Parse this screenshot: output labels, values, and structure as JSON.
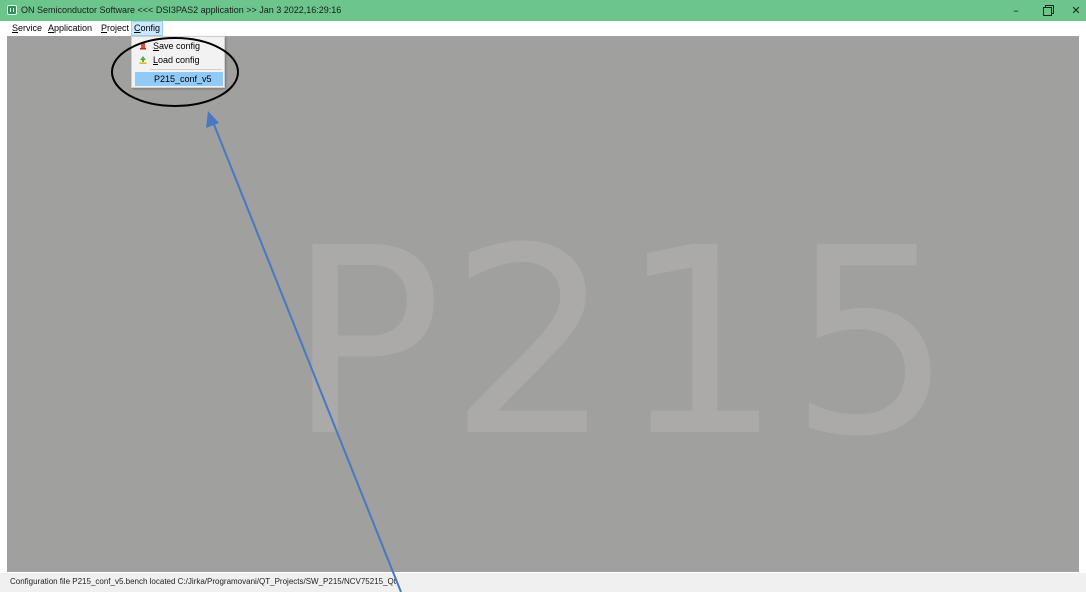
{
  "window": {
    "title": "ON Semiconductor Software <<< DSI3PAS2 application >> Jan  3 2022,16:29:16",
    "minimize_glyph": "–",
    "close_glyph": "✕"
  },
  "menubar": {
    "service": {
      "first": "S",
      "rest": "ervice"
    },
    "application": {
      "first": "A",
      "rest": "pplication"
    },
    "project": {
      "first": "P",
      "rest": "roject"
    },
    "config": {
      "first": "C",
      "rest": "onfig"
    }
  },
  "config_menu": {
    "save": {
      "first": "S",
      "rest": "ave config",
      "icon": "save-config-icon"
    },
    "load": {
      "first": "L",
      "rest": "oad config",
      "icon": "load-config-icon"
    },
    "recent_file": "P215_conf_v5"
  },
  "main": {
    "watermark": "P215",
    "background_color": "#a0a09e"
  },
  "statusbar": {
    "text": "Configuration file P215_conf_v5.bench located C:/Jirka/Programovani/QT_Projects/SW_P215/NCV75215_Qt"
  },
  "colors": {
    "titlebar": "#6cc68c",
    "highlight": "#91c9f7",
    "annotation_arrow": "#4a78c0",
    "annotation_ellipse": "#000000"
  }
}
